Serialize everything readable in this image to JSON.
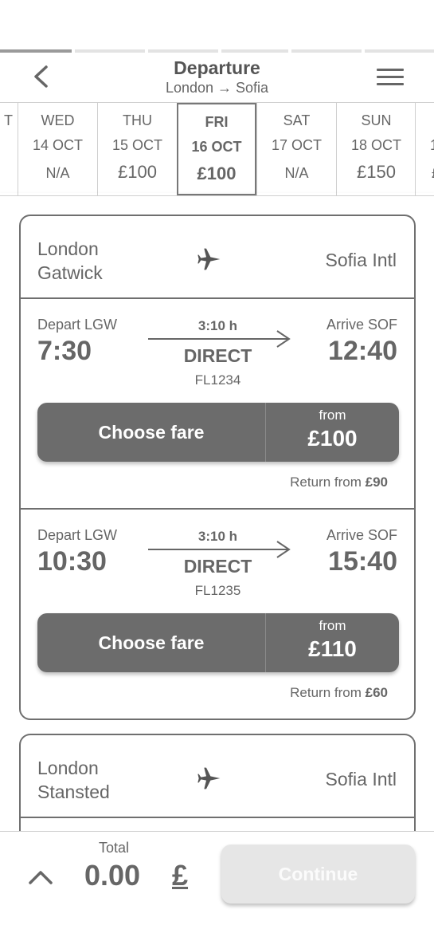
{
  "header": {
    "title": "Departure",
    "subtitle": "London → Sofia"
  },
  "progress": {
    "steps": 6,
    "active_step": 1
  },
  "dates": [
    {
      "dow": "T",
      "date": "",
      "price": ""
    },
    {
      "dow": "WED",
      "date": "14 OCT",
      "price": "N/A"
    },
    {
      "dow": "THU",
      "date": "15 OCT",
      "price": "£100"
    },
    {
      "dow": "FRI",
      "date": "16 OCT",
      "price": "£100",
      "selected": true
    },
    {
      "dow": "SAT",
      "date": "17 OCT",
      "price": "N/A"
    },
    {
      "dow": "SUN",
      "date": "18 OCT",
      "price": "£150"
    },
    {
      "dow": "1",
      "date": "",
      "price": "£"
    }
  ],
  "cards": [
    {
      "origin": "London\nGatwick",
      "destination": "Sofia Intl",
      "flights": [
        {
          "depart_label": "Depart LGW",
          "depart_time": "7:30",
          "duration": "3:10 h",
          "type": "DIRECT",
          "flight_no": "FL1234",
          "arrive_label": "Arrive SOF",
          "arrive_time": "12:40",
          "fare_label": "Choose fare",
          "from_label": "from",
          "price": "£100",
          "return_prefix": "Return from ",
          "return_price": "£90"
        },
        {
          "depart_label": "Depart LGW",
          "depart_time": "10:30",
          "duration": "3:10 h",
          "type": "DIRECT",
          "flight_no": "FL1235",
          "arrive_label": "Arrive SOF",
          "arrive_time": "15:40",
          "fare_label": "Choose fare",
          "from_label": "from",
          "price": "£110",
          "return_prefix": "Return from ",
          "return_price": "£60"
        }
      ]
    },
    {
      "origin": "London\nStansted",
      "destination": "Sofia Intl",
      "flights": []
    }
  ],
  "footer": {
    "total_label": "Total",
    "total_value": "0.00",
    "currency": "£",
    "continue_label": "Continue"
  },
  "icons": {
    "back": "chevron-left-icon",
    "menu": "hamburger-menu-icon",
    "plane": "airplane-icon",
    "arrow": "arrow-right-icon",
    "expand": "chevron-up-icon"
  },
  "colors": {
    "button": "#6c6c6c",
    "border": "#6f6f6f",
    "disabled_button": "#e6e6e6",
    "text": "#666666"
  }
}
